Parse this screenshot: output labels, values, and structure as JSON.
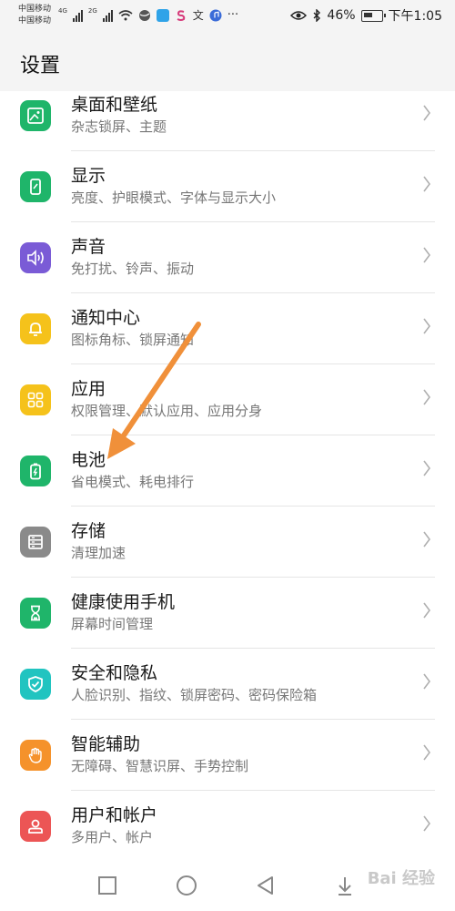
{
  "status_bar": {
    "carrier1": "中国移动",
    "carrier2": "中国移动",
    "net1": "4G",
    "net2": "2G",
    "battery_pct": "46%",
    "time": "下午1:05",
    "more": "···"
  },
  "header": {
    "title": "设置"
  },
  "items": [
    {
      "label": "桌面和壁纸",
      "sub": "杂志锁屏、主题",
      "color": "#1fb56a"
    },
    {
      "label": "显示",
      "sub": "亮度、护眼模式、字体与显示大小",
      "color": "#1fb56a"
    },
    {
      "label": "声音",
      "sub": "免打扰、铃声、振动",
      "color": "#7a5bd6"
    },
    {
      "label": "通知中心",
      "sub": "图标角标、锁屏通知",
      "color": "#f5c21b"
    },
    {
      "label": "应用",
      "sub": "权限管理、默认应用、应用分身",
      "color": "#f5c21b"
    },
    {
      "label": "电池",
      "sub": "省电模式、耗电排行",
      "color": "#1fb56a"
    },
    {
      "label": "存储",
      "sub": "清理加速",
      "color": "#8a8a8a"
    },
    {
      "label": "健康使用手机",
      "sub": "屏幕时间管理",
      "color": "#1fb56a"
    },
    {
      "label": "安全和隐私",
      "sub": "人脸识别、指纹、锁屏密码、密码保险箱",
      "color": "#21c4c0"
    },
    {
      "label": "智能辅助",
      "sub": "无障碍、智慧识屏、手势控制",
      "color": "#f5922b"
    },
    {
      "label": "用户和帐户",
      "sub": "多用户、帐户",
      "color": "#ec5555"
    }
  ],
  "annotation": {
    "arrow_color": "#f0903a"
  },
  "watermark": "Bai 经验"
}
